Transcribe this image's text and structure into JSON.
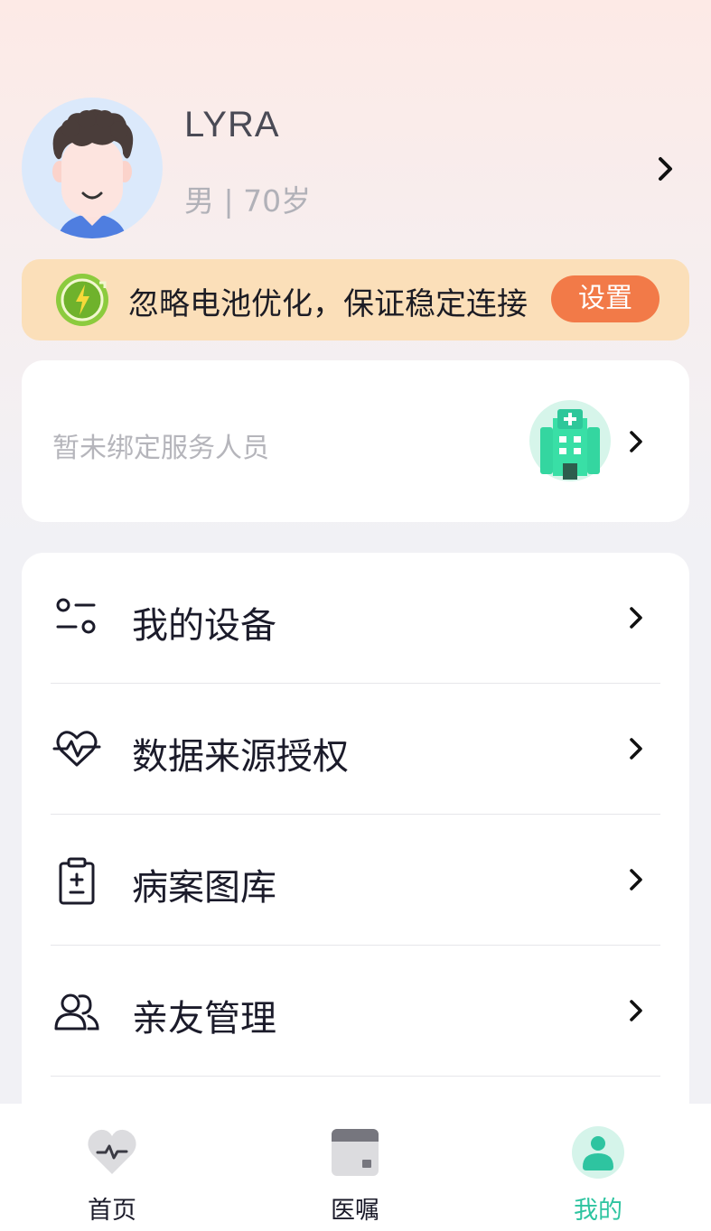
{
  "profile": {
    "name": "LYRA",
    "meta": "男 | 70岁"
  },
  "battery_banner": {
    "text": "忽略电池优化，保证稳定连接",
    "button_label": "设置"
  },
  "service": {
    "text": "暂未绑定服务人员"
  },
  "menu": {
    "items": [
      {
        "label": "我的设备",
        "icon": "device-settings-icon"
      },
      {
        "label": "数据来源授权",
        "icon": "heart-pulse-icon"
      },
      {
        "label": "病案图库",
        "icon": "clipboard-medical-icon"
      },
      {
        "label": "亲友管理",
        "icon": "users-icon"
      }
    ]
  },
  "tabs": [
    {
      "label": "首页",
      "icon": "heart-rate-icon",
      "active": false
    },
    {
      "label": "医嘱",
      "icon": "card-icon",
      "active": false
    },
    {
      "label": "我的",
      "icon": "person-icon",
      "active": true
    }
  ],
  "colors": {
    "accent": "#2ec4a0",
    "banner_bg": "#fbdfb9",
    "button_orange": "#f27a48"
  }
}
